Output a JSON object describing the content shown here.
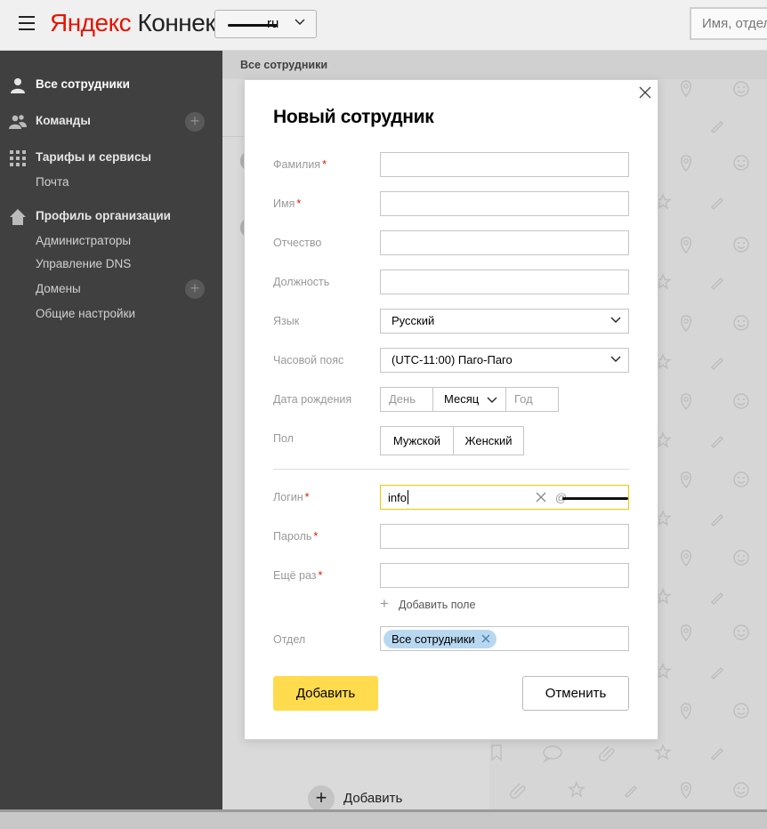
{
  "header": {
    "logo_ya": "Яндекс",
    "logo_rest": "Коннект",
    "org_domain": "ru",
    "search_placeholder": "Имя, отдел"
  },
  "sidebar": {
    "all_employees": "Все сотрудники",
    "teams": "Команды",
    "tariffs": "Тарифы и сервисы",
    "mail": "Почта",
    "org_profile": "Профиль организации",
    "admins": "Администраторы",
    "dns": "Управление DNS",
    "domains": "Домены",
    "general": "Общие настройки"
  },
  "content": {
    "list_header": "Все сотрудники",
    "add_label": "Добавить"
  },
  "modal": {
    "title": "Новый сотрудник",
    "labels": {
      "last_name": "Фамилия",
      "first_name": "Имя",
      "middle_name": "Отчество",
      "position": "Должность",
      "language": "Язык",
      "timezone": "Часовой пояс",
      "birth_date": "Дата рождения",
      "gender": "Пол",
      "login": "Логин",
      "password": "Пароль",
      "password_repeat": "Ещё раз",
      "department": "Отдел"
    },
    "required_mark": "*",
    "language_value": "Русский",
    "timezone_value": "(UTC-11:00) Паго-Паго",
    "date": {
      "day": "День",
      "month": "Месяц",
      "year": "Год"
    },
    "gender": {
      "male": "Мужской",
      "female": "Женский"
    },
    "login_value": "info",
    "login_domain_prefix": "@",
    "add_field": "Добавить поле",
    "department_chip": "Все сотрудники",
    "submit": "Добавить",
    "cancel": "Отменить"
  },
  "colors": {
    "accent_yellow": "#ffdb4d",
    "brand_red": "#e61400",
    "sidebar_bg": "#404040",
    "chip_blue": "#b8d8f0"
  }
}
